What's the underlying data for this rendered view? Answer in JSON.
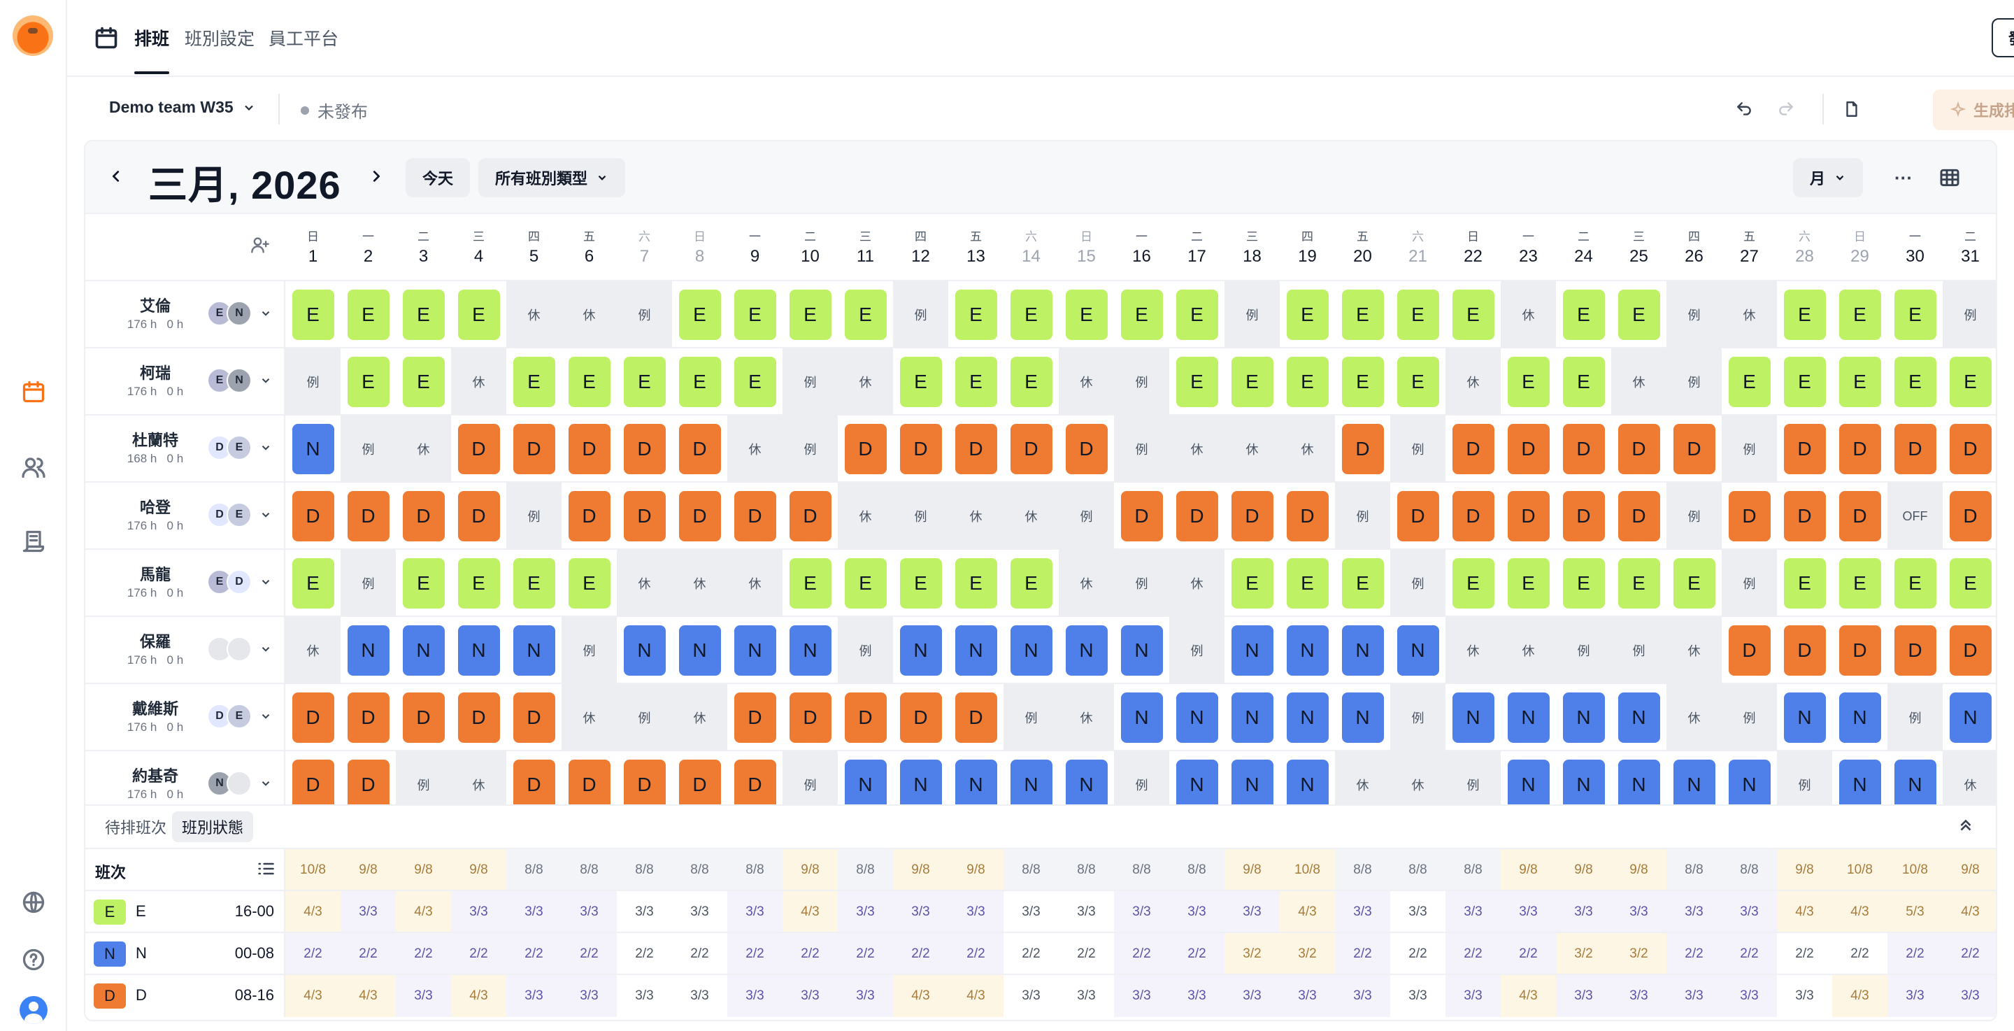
{
  "nav": {
    "tabs": [
      "排班",
      "班別設定",
      "員工平台"
    ],
    "publish": "發布"
  },
  "subbar": {
    "team": "Demo team W35",
    "status": "未發布",
    "generate": "生成排班"
  },
  "toolbar": {
    "month_title": "三月, 2026",
    "today": "今天",
    "shift_filter": "所有班別類型",
    "view": "月",
    "more": "···"
  },
  "days": [
    {
      "wd": "日",
      "d": "1"
    },
    {
      "wd": "一",
      "d": "2"
    },
    {
      "wd": "二",
      "d": "3"
    },
    {
      "wd": "三",
      "d": "4"
    },
    {
      "wd": "四",
      "d": "5"
    },
    {
      "wd": "五",
      "d": "6"
    },
    {
      "wd": "六",
      "d": "7"
    },
    {
      "wd": "日",
      "d": "8"
    },
    {
      "wd": "一",
      "d": "9"
    },
    {
      "wd": "二",
      "d": "10"
    },
    {
      "wd": "三",
      "d": "11"
    },
    {
      "wd": "四",
      "d": "12"
    },
    {
      "wd": "五",
      "d": "13"
    },
    {
      "wd": "六",
      "d": "14"
    },
    {
      "wd": "日",
      "d": "15"
    },
    {
      "wd": "一",
      "d": "16"
    },
    {
      "wd": "二",
      "d": "17"
    },
    {
      "wd": "三",
      "d": "18"
    },
    {
      "wd": "四",
      "d": "19"
    },
    {
      "wd": "五",
      "d": "20"
    },
    {
      "wd": "六",
      "d": "21"
    },
    {
      "wd": "日",
      "d": "22"
    },
    {
      "wd": "一",
      "d": "23"
    },
    {
      "wd": "二",
      "d": "24"
    },
    {
      "wd": "三",
      "d": "25"
    },
    {
      "wd": "四",
      "d": "26"
    },
    {
      "wd": "五",
      "d": "27"
    },
    {
      "wd": "六",
      "d": "28"
    },
    {
      "wd": "日",
      "d": "29"
    },
    {
      "wd": "一",
      "d": "30"
    },
    {
      "wd": "二",
      "d": "31"
    }
  ],
  "weekend_indexes": [
    6,
    7,
    13,
    14,
    20,
    27,
    28
  ],
  "employees": [
    {
      "name": "艾倫",
      "hours": "176 h   0 h",
      "pref": [
        {
          "c": "E",
          "color": "#b9bbd6"
        },
        {
          "c": "N",
          "color": "#9ca3af"
        }
      ],
      "shifts": [
        "E",
        "E",
        "E",
        "E",
        "休",
        "休",
        "例",
        "E",
        "E",
        "E",
        "E",
        "例",
        "E",
        "E",
        "E",
        "E",
        "E",
        "例",
        "E",
        "E",
        "E",
        "E",
        "休",
        "E",
        "E",
        "例",
        "休",
        "E",
        "E",
        "E",
        "例"
      ]
    },
    {
      "name": "柯瑞",
      "hours": "176 h   0 h",
      "pref": [
        {
          "c": "E",
          "color": "#b9bbd6"
        },
        {
          "c": "N",
          "color": "#9ca3af"
        }
      ],
      "shifts": [
        "例",
        "E",
        "E",
        "休",
        "E",
        "E",
        "E",
        "E",
        "E",
        "例",
        "休",
        "E",
        "E",
        "E",
        "休",
        "例",
        "E",
        "E",
        "E",
        "E",
        "E",
        "休",
        "E",
        "E",
        "休",
        "例",
        "E",
        "E",
        "E",
        "E",
        "E"
      ]
    },
    {
      "name": "杜蘭特",
      "hours": "168 h   0 h",
      "pref": [
        {
          "c": "D",
          "color": "#e0e7ff"
        },
        {
          "c": "E",
          "color": "#c7cbe0"
        }
      ],
      "shifts": [
        "N",
        "例",
        "休",
        "D",
        "D",
        "D",
        "D",
        "D",
        "休",
        "例",
        "D",
        "D",
        "D",
        "D",
        "D",
        "例",
        "休",
        "休",
        "休",
        "D",
        "例",
        "D",
        "D",
        "D",
        "D",
        "D",
        "例",
        "D",
        "D",
        "D",
        "D"
      ]
    },
    {
      "name": "哈登",
      "hours": "176 h   0 h",
      "pref": [
        {
          "c": "D",
          "color": "#e0e7ff"
        },
        {
          "c": "E",
          "color": "#c7cbe0"
        }
      ],
      "shifts": [
        "D",
        "D",
        "D",
        "D",
        "例",
        "D",
        "D",
        "D",
        "D",
        "D",
        "休",
        "例",
        "休",
        "休",
        "例",
        "D",
        "D",
        "D",
        "D",
        "例",
        "D",
        "D",
        "D",
        "D",
        "D",
        "例",
        "D",
        "D",
        "D",
        "OFF",
        "D"
      ]
    },
    {
      "name": "馬龍",
      "hours": "176 h   0 h",
      "pref": [
        {
          "c": "E",
          "color": "#b9bbd6"
        },
        {
          "c": "D",
          "color": "#e0e7ff"
        }
      ],
      "shifts": [
        "E",
        "例",
        "E",
        "E",
        "E",
        "E",
        "休",
        "休",
        "休",
        "E",
        "E",
        "E",
        "E",
        "E",
        "休",
        "例",
        "休",
        "E",
        "E",
        "E",
        "例",
        "E",
        "E",
        "E",
        "E",
        "E",
        "例",
        "E",
        "E",
        "E",
        "E"
      ]
    },
    {
      "name": "保羅",
      "hours": "176 h   0 h",
      "pref": [
        {
          "c": "",
          "color": "#e5e7eb"
        },
        {
          "c": "",
          "color": "#e5e7eb"
        }
      ],
      "shifts": [
        "休",
        "N",
        "N",
        "N",
        "N",
        "例",
        "N",
        "N",
        "N",
        "N",
        "例",
        "N",
        "N",
        "N",
        "N",
        "N",
        "例",
        "N",
        "N",
        "N",
        "N",
        "休",
        "休",
        "例",
        "例",
        "休",
        "D",
        "D",
        "D",
        "D",
        "D"
      ]
    },
    {
      "name": "戴維斯",
      "hours": "176 h   0 h",
      "pref": [
        {
          "c": "D",
          "color": "#e0e7ff"
        },
        {
          "c": "E",
          "color": "#c7cbe0"
        }
      ],
      "shifts": [
        "D",
        "D",
        "D",
        "D",
        "D",
        "休",
        "例",
        "休",
        "D",
        "D",
        "D",
        "D",
        "D",
        "例",
        "休",
        "N",
        "N",
        "N",
        "N",
        "N",
        "例",
        "N",
        "N",
        "N",
        "N",
        "休",
        "例",
        "N",
        "N",
        "例",
        "N"
      ]
    },
    {
      "name": "約基奇",
      "hours": "176 h   0 h",
      "pref": [
        {
          "c": "N",
          "color": "#9ca3af"
        },
        {
          "c": "",
          "color": "#e5e7eb"
        }
      ],
      "shifts": [
        "D",
        "D",
        "例",
        "休",
        "D",
        "D",
        "D",
        "D",
        "D",
        "例",
        "N",
        "N",
        "N",
        "N",
        "N",
        "例",
        "N",
        "N",
        "N",
        "休",
        "休",
        "例",
        "N",
        "N",
        "N",
        "N",
        "N",
        "例",
        "N",
        "N",
        "休"
      ]
    }
  ],
  "bottom": {
    "tabs": [
      "待排班次",
      "班別狀態"
    ],
    "header": "班次",
    "totals": [
      "10/8",
      "9/8",
      "9/8",
      "9/8",
      "8/8",
      "8/8",
      "8/8",
      "8/8",
      "8/8",
      "9/8",
      "8/8",
      "9/8",
      "9/8",
      "8/8",
      "8/8",
      "8/8",
      "8/8",
      "9/8",
      "10/8",
      "8/8",
      "8/8",
      "8/8",
      "9/8",
      "9/8",
      "9/8",
      "8/8",
      "8/8",
      "9/8",
      "10/8",
      "10/8",
      "9/8"
    ],
    "shifts": [
      {
        "code": "E",
        "time": "16-00",
        "color": "#bef264",
        "values": [
          "4/3",
          "3/3",
          "4/3",
          "3/3",
          "3/3",
          "3/3",
          "3/3",
          "3/3",
          "3/3",
          "4/3",
          "3/3",
          "3/3",
          "3/3",
          "3/3",
          "3/3",
          "3/3",
          "3/3",
          "3/3",
          "4/3",
          "3/3",
          "3/3",
          "3/3",
          "3/3",
          "3/3",
          "3/3",
          "3/3",
          "3/3",
          "4/3",
          "4/3",
          "5/3",
          "4/3"
        ]
      },
      {
        "code": "N",
        "time": "00-08",
        "color": "#4f7fe8",
        "values": [
          "2/2",
          "2/2",
          "2/2",
          "2/2",
          "2/2",
          "2/2",
          "2/2",
          "2/2",
          "2/2",
          "2/2",
          "2/2",
          "2/2",
          "2/2",
          "2/2",
          "2/2",
          "2/2",
          "2/2",
          "3/2",
          "3/2",
          "2/2",
          "2/2",
          "2/2",
          "2/2",
          "3/2",
          "3/2",
          "2/2",
          "2/2",
          "2/2",
          "2/2",
          "2/2",
          "2/2"
        ]
      },
      {
        "code": "D",
        "time": "08-16",
        "color": "#ef7b32",
        "values": [
          "4/3",
          "4/3",
          "3/3",
          "4/3",
          "3/3",
          "3/3",
          "3/3",
          "3/3",
          "3/3",
          "3/3",
          "3/3",
          "4/3",
          "4/3",
          "3/3",
          "3/3",
          "3/3",
          "3/3",
          "3/3",
          "3/3",
          "3/3",
          "3/3",
          "3/3",
          "4/3",
          "3/3",
          "3/3",
          "3/3",
          "3/3",
          "3/3",
          "4/3",
          "3/3",
          "3/3"
        ]
      }
    ]
  }
}
